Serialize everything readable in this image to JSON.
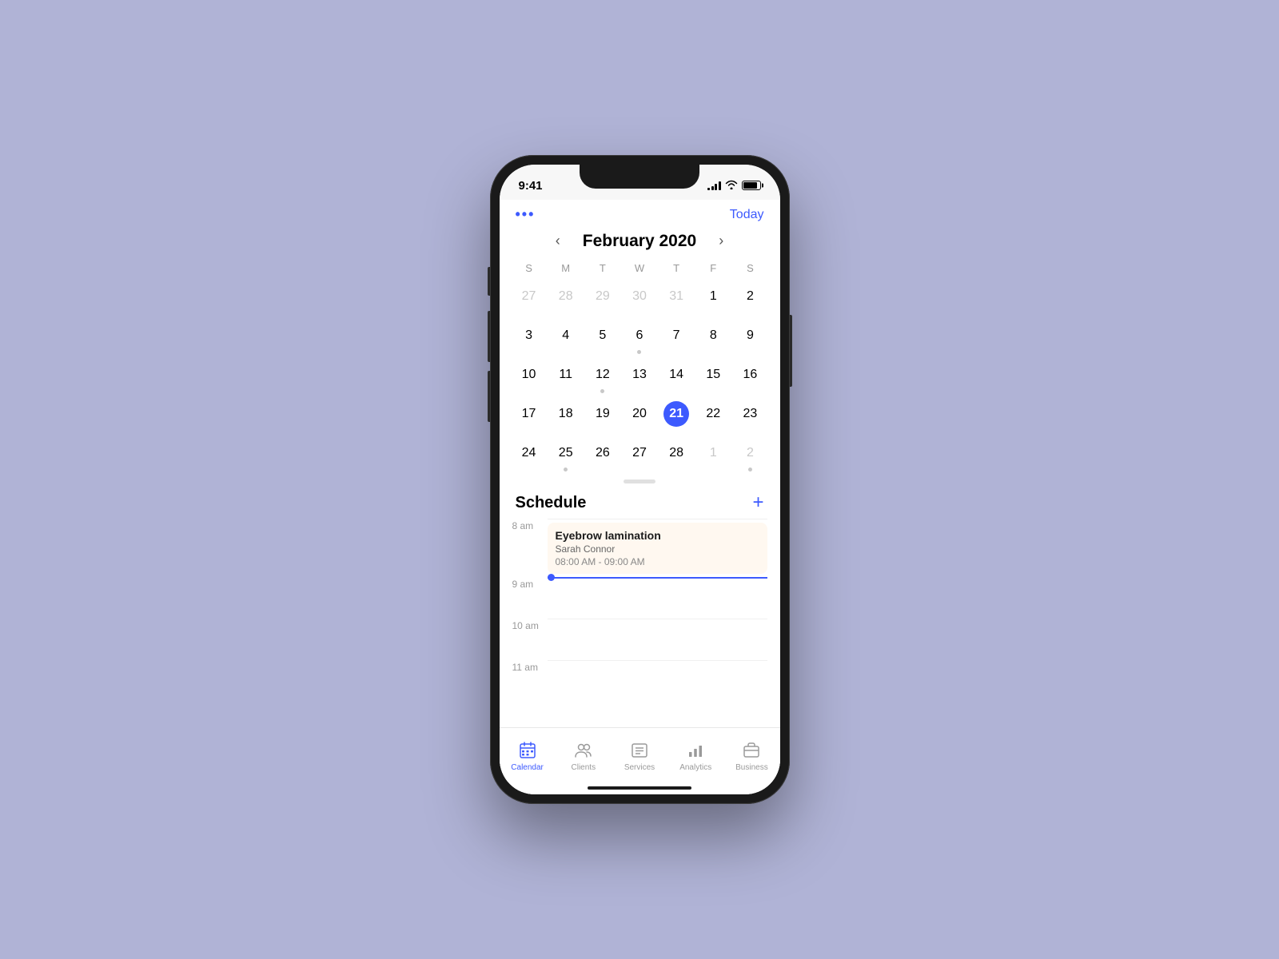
{
  "status_bar": {
    "time": "9:41",
    "signal_bars": [
      3,
      6,
      9,
      12,
      12
    ],
    "battery_level": "85%"
  },
  "header": {
    "more_dots": "•••",
    "today_label": "Today"
  },
  "calendar": {
    "month_title": "February 2020",
    "day_headers": [
      "S",
      "M",
      "T",
      "W",
      "T",
      "F",
      "S"
    ],
    "weeks": [
      [
        {
          "day": "27",
          "other": true,
          "dot": false
        },
        {
          "day": "28",
          "other": true,
          "dot": false
        },
        {
          "day": "29",
          "other": true,
          "dot": false
        },
        {
          "day": "30",
          "other": true,
          "dot": false
        },
        {
          "day": "31",
          "other": true,
          "dot": false
        },
        {
          "day": "1",
          "other": false,
          "dot": false
        },
        {
          "day": "2",
          "other": false,
          "dot": false
        }
      ],
      [
        {
          "day": "3",
          "other": false,
          "dot": false
        },
        {
          "day": "4",
          "other": false,
          "dot": false
        },
        {
          "day": "5",
          "other": false,
          "dot": false
        },
        {
          "day": "6",
          "other": false,
          "dot": true
        },
        {
          "day": "7",
          "other": false,
          "dot": false
        },
        {
          "day": "8",
          "other": false,
          "dot": false
        },
        {
          "day": "9",
          "other": false,
          "dot": false
        }
      ],
      [
        {
          "day": "10",
          "other": false,
          "dot": false
        },
        {
          "day": "11",
          "other": false,
          "dot": false
        },
        {
          "day": "12",
          "other": false,
          "dot": true
        },
        {
          "day": "13",
          "other": false,
          "dot": false
        },
        {
          "day": "14",
          "other": false,
          "dot": false
        },
        {
          "day": "15",
          "other": false,
          "dot": false
        },
        {
          "day": "16",
          "other": false,
          "dot": false
        }
      ],
      [
        {
          "day": "17",
          "other": false,
          "dot": false
        },
        {
          "day": "18",
          "other": false,
          "dot": false
        },
        {
          "day": "19",
          "other": false,
          "dot": false
        },
        {
          "day": "20",
          "other": false,
          "dot": false
        },
        {
          "day": "21",
          "other": false,
          "dot": false,
          "selected": true
        },
        {
          "day": "22",
          "other": false,
          "dot": false
        },
        {
          "day": "23",
          "other": false,
          "dot": false
        }
      ],
      [
        {
          "day": "24",
          "other": false,
          "dot": false
        },
        {
          "day": "25",
          "other": false,
          "dot": true
        },
        {
          "day": "26",
          "other": false,
          "dot": false
        },
        {
          "day": "27",
          "other": false,
          "dot": false
        },
        {
          "day": "28",
          "other": false,
          "dot": false
        },
        {
          "day": "1",
          "other": true,
          "dot": false
        },
        {
          "day": "2",
          "other": true,
          "dot": true
        }
      ]
    ]
  },
  "schedule": {
    "title": "Schedule",
    "add_label": "+",
    "time_slots": [
      {
        "time": "8 am",
        "has_event": true,
        "has_current_line": false
      },
      {
        "time": "9 am",
        "has_event": false,
        "has_current_line": true
      },
      {
        "time": "10 am",
        "has_event": false,
        "has_current_line": false
      },
      {
        "time": "11 am",
        "has_event": false,
        "has_current_line": false
      }
    ],
    "event": {
      "title": "Eyebrow lamination",
      "client": "Sarah Connor",
      "time_range": "08:00 AM - 09:00 AM"
    }
  },
  "tab_bar": {
    "items": [
      {
        "label": "Calendar",
        "active": true
      },
      {
        "label": "Clients",
        "active": false
      },
      {
        "label": "Services",
        "active": false
      },
      {
        "label": "Analytics",
        "active": false
      },
      {
        "label": "Business",
        "active": false
      }
    ]
  }
}
